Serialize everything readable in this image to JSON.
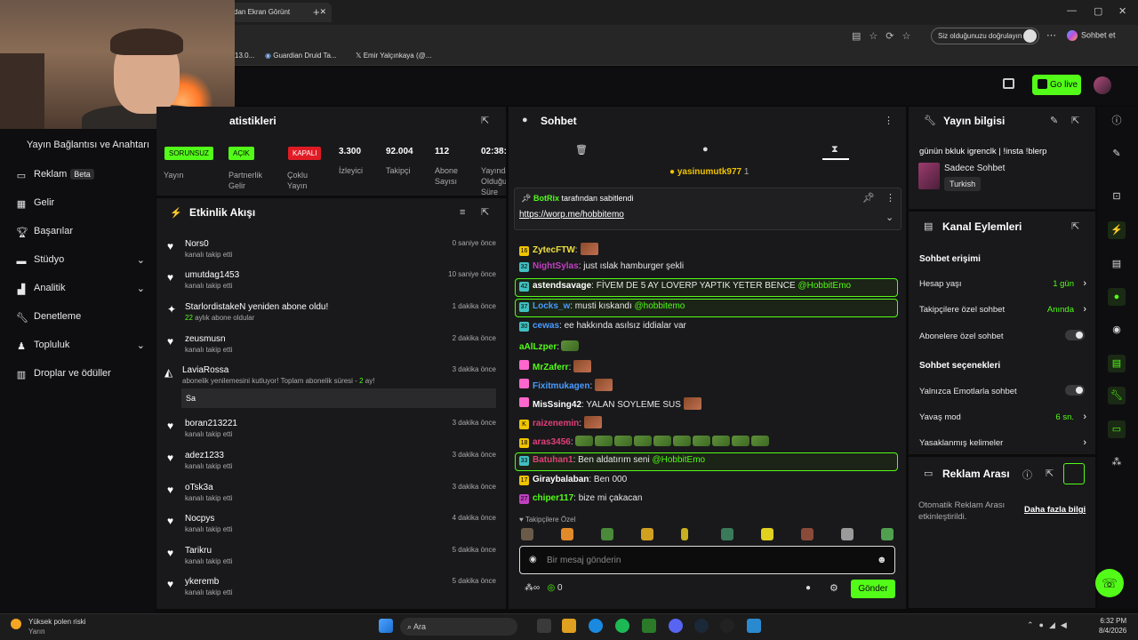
{
  "browser": {
    "tab_title": "dan Ekran Görünt",
    "incognito_label": "Siz olduğunuzu doğrulayın",
    "copilot_label": "Sohbet et",
    "bookmarks": [
      "13.0...",
      "Guardian Druid Ta...",
      "Emir Yalçınkaya (@..."
    ]
  },
  "header": {
    "go_live_label": "Go live"
  },
  "leftnav": {
    "header": "Yayın Bağlantısı ve Anahtarı",
    "items": [
      {
        "label": "Reklam",
        "badge": "Beta",
        "icon": "tv-icon"
      },
      {
        "label": "Gelir",
        "icon": "chart-icon"
      },
      {
        "label": "Başarılar",
        "icon": "trophy-icon"
      },
      {
        "label": "Stüdyo",
        "icon": "studio-icon"
      },
      {
        "label": "Analitik",
        "icon": "analytics-icon"
      },
      {
        "label": "Denetleme",
        "icon": "wrench-icon"
      },
      {
        "label": "Topluluk",
        "icon": "community-icon"
      },
      {
        "label": "Droplar ve ödüller",
        "icon": "gift-icon"
      }
    ]
  },
  "stats": {
    "title": "atistikleri",
    "items": [
      {
        "tag": "SORUNSUZ",
        "tag_color": "#53fc18",
        "label": "Yayın"
      },
      {
        "tag": "AÇIK",
        "tag_color": "#53fc18",
        "label": "Partnerlik Gelir"
      },
      {
        "tag": "KAPALI",
        "tag_color": "#e01b24",
        "label": "Çoklu Yayın"
      },
      {
        "value": "3.300",
        "label": "İzleyici"
      },
      {
        "value": "92.004",
        "label": "Takipçi"
      },
      {
        "value": "112",
        "label": "Abone Sayısı"
      },
      {
        "value": "02:38:",
        "label": "Yayında Olduğu Süre"
      }
    ]
  },
  "activity": {
    "title": "Etkinlik Akışı",
    "events": [
      {
        "name": "Nors0",
        "sub": "kanalı takip etti",
        "time": "0 saniye önce",
        "icon": "heart-icon"
      },
      {
        "name": "umutdag1453",
        "sub": "kanalı takip etti",
        "time": "10 saniye önce",
        "icon": "heart-icon"
      },
      {
        "name": "StarlordistakeN yeniden abone oldu!",
        "sub": "aylık abone oldular",
        "sub_num": "22",
        "time": "1 dakika önce",
        "icon": "star-icon"
      },
      {
        "name": "zeusmusn",
        "sub": "kanalı takip etti",
        "time": "2 dakika önce",
        "icon": "heart-icon"
      },
      {
        "name": "LaviaRossa",
        "sub": "abonelik yenilemesini kutluyor! Toplam abonelik süresi - ",
        "sub_num": "2",
        "sub_tail": " ay!",
        "time": "3 dakika önce",
        "icon": "party-icon"
      },
      {
        "name": "boran213221",
        "sub": "kanalı takip etti",
        "time": "3 dakika önce",
        "icon": "heart-icon"
      },
      {
        "name": "adez1233",
        "sub": "kanalı takip etti",
        "time": "3 dakika önce",
        "icon": "heart-icon"
      },
      {
        "name": "oTsk3a",
        "sub": "kanalı takip etti",
        "time": "3 dakika önce",
        "icon": "heart-icon"
      },
      {
        "name": "Nocpys",
        "sub": "kanalı takip etti",
        "time": "4 dakika önce",
        "icon": "heart-icon"
      },
      {
        "name": "Tarikru",
        "sub": "kanalı takip etti",
        "time": "5 dakika önce",
        "icon": "heart-icon"
      },
      {
        "name": "ykeremb",
        "sub": "kanalı takip etti",
        "time": "5 dakika önce",
        "icon": "heart-icon"
      }
    ],
    "sub_message": "Sa"
  },
  "chat": {
    "title": "Sohbet",
    "gifter": "yasinumutk977",
    "gifter_count": "1",
    "pinned_by": "BotRix",
    "pinned_suffix": "tarafından sabitlendi",
    "pinned_link": "https://worp.me/hobbitemo",
    "messages": [
      {
        "user": "ZytecFTW",
        "text": ":",
        "color": "#f0e040",
        "badge": "16",
        "badge_color": "#f0c400",
        "emote": true
      },
      {
        "user": "NightSylas",
        "text": ": just ıslak hamburger şekli",
        "color": "#c040c0",
        "badge": "32",
        "badge_color": "#40c0c0"
      },
      {
        "user": "astendsavage",
        "text": ": FİVEM DE 5 AY LOVERP YAPTIK YETER BENCE ",
        "mention": "@HobbitEmo",
        "color": "#ffffff",
        "badge": "42",
        "badge_color": "#40c0c0",
        "highlight": true
      },
      {
        "user": "Locks_w",
        "text": ": musti kıskandı ",
        "mention": "@hobbitemo",
        "color": "#4a9cff",
        "badge": "37",
        "badge_color": "#40c0c0",
        "highlight": true
      },
      {
        "user": "cewas",
        "text": ": ee hakkında asılsız iddialar var",
        "color": "#4a9cff",
        "badge": "30",
        "badge_color": "#40c0c0"
      },
      {
        "user": "aAlLzper",
        "text": ":",
        "color": "#53fc18",
        "pepe": 1
      },
      {
        "user": "MrZaferr",
        "text": ":",
        "color": "#53fc18",
        "badge": "",
        "badge_color": "#ff66cc",
        "emote": true
      },
      {
        "user": "Fixitmukagen",
        "text": ":",
        "color": "#4a9cff",
        "badge": "",
        "badge_color": "#ff66cc",
        "emote": true
      },
      {
        "user": "MisSsing42",
        "text": ": YALAN SOYLEME SUS",
        "color": "#ffffff",
        "badge": "",
        "badge_color": "#ff66cc",
        "emote": true
      },
      {
        "user": "raizenemin",
        "text": ":",
        "color": "#e0407a",
        "badge": "K",
        "badge_color": "#f0c400",
        "emote": true
      },
      {
        "user": "aras3456",
        "text": ":",
        "color": "#e0407a",
        "badge": "18",
        "badge_color": "#f0c400",
        "pepe": 10
      },
      {
        "user": "Batuhan1",
        "text": ": Ben aldatırım seni ",
        "mention": "@HobbitEmo",
        "color": "#e0407a",
        "badge": "33",
        "badge_color": "#40c0c0",
        "highlight": true
      },
      {
        "user": "Giraybalaban",
        "text": ": Ben 000",
        "color": "#ffffff",
        "badge": "17",
        "badge_color": "#f0c400"
      },
      {
        "user": "chiper117",
        "text": ": bize mi çakacan",
        "color": "#53fc18",
        "badge": "27",
        "badge_color": "#c040c0"
      }
    ],
    "followers_only": "Takipçilere Özel",
    "input_placeholder": "Bir mesaj gönderin",
    "points": "0",
    "send_label": "Gönder"
  },
  "info": {
    "title": "Yayın bilgisi",
    "stream_title": "günün bkluk igrenclk | !insta !blerp",
    "category": "Sadece Sohbet",
    "language": "Turkish"
  },
  "channel_actions": {
    "title": "Kanal Eylemleri",
    "access_title": "Sohbet erişimi",
    "access_rows": [
      {
        "label": "Hesap yaşı",
        "value": "1 gün",
        "type": "chevron"
      },
      {
        "label": "Takipçilere özel sohbet",
        "value": "Anında",
        "type": "chevron"
      },
      {
        "label": "Abonelere özel sohbet",
        "value": "",
        "type": "toggle"
      }
    ],
    "options_title": "Sohbet seçenekleri",
    "option_rows": [
      {
        "label": "Yalnızca Emotlarla sohbet",
        "value": "",
        "type": "toggle"
      },
      {
        "label": "Yavaş mod",
        "value": "6 sn.",
        "type": "chevron"
      },
      {
        "label": "Yasaklanmış kelimeler",
        "value": "",
        "type": "chevron"
      }
    ]
  },
  "ad_break": {
    "title": "Reklam Arası",
    "description": "Otomatik Reklam Arası etkinleştirildi.",
    "more_link": "Daha fazla bilgi"
  },
  "taskbar": {
    "weather_title": "Yüksek polen riski",
    "weather_sub": "Yarın",
    "search_label": "Ara",
    "time": "6:32 PM",
    "date": "8/4/2026"
  },
  "colors": {
    "accent": "#53fc18",
    "panel": "#19191b",
    "background": "#0b0b0b"
  }
}
